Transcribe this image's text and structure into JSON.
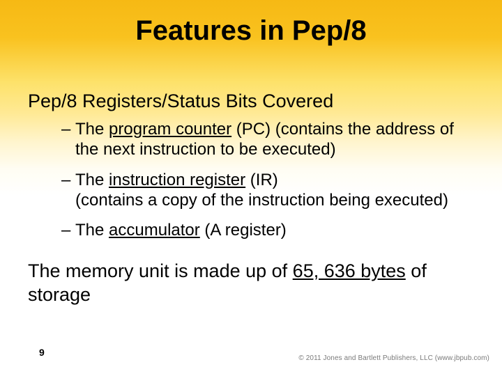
{
  "title": "Features in Pep/8",
  "subhead": "Pep/8 Registers/Status Bits Covered",
  "bullets": [
    {
      "pre": "The ",
      "u": "program counter",
      "post": " (PC) (contains the address of the next instruction to be executed)"
    },
    {
      "pre": "The ",
      "u": "instruction register",
      "post": " (IR)\n(contains a copy of the instruction being executed)"
    },
    {
      "pre": "The ",
      "u": "accumulator",
      "post": " (A register)"
    }
  ],
  "para": {
    "pre": "The memory unit is made up of  ",
    "u": "65, 636 bytes",
    "post": " of storage"
  },
  "page_number": "9",
  "copyright": "© 2011 Jones and Bartlett Publishers, LLC (www.jbpub.com)",
  "dash": "–"
}
